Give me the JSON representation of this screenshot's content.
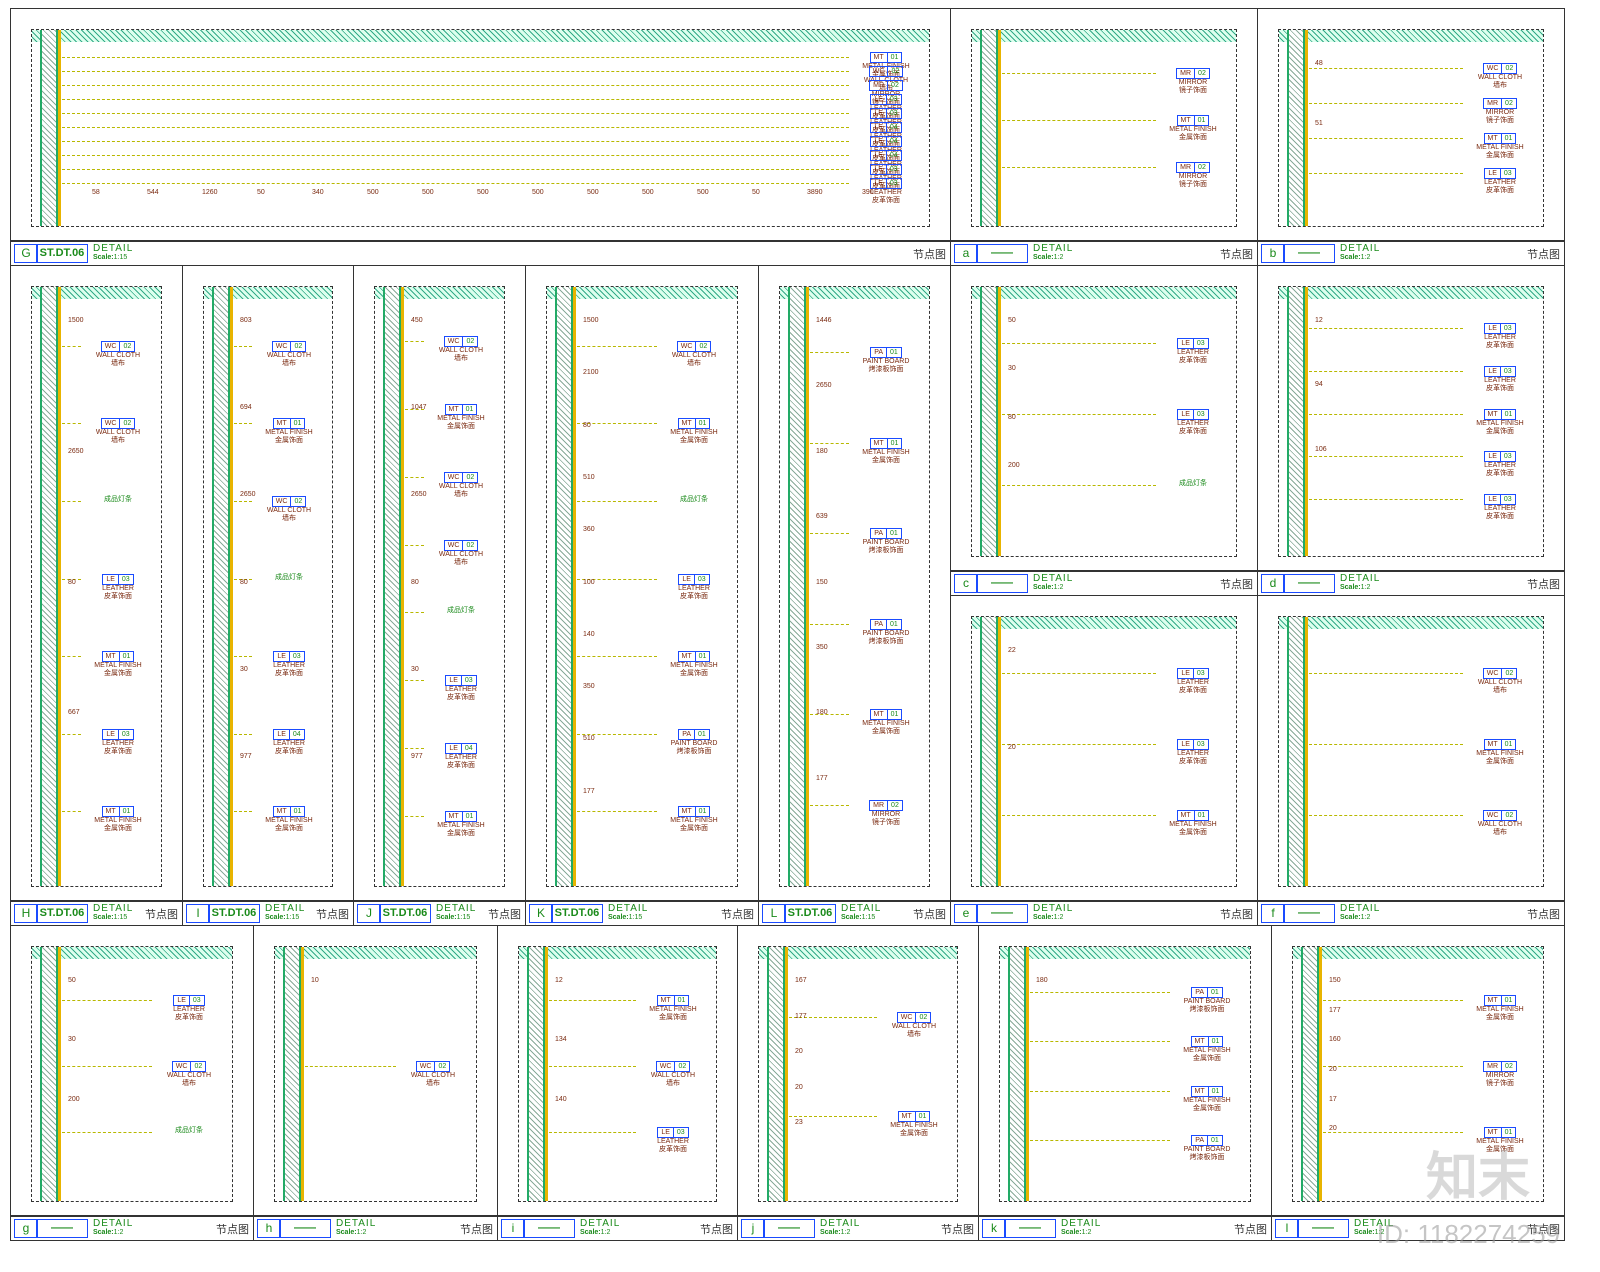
{
  "materials": {
    "MT": {
      "en": "METAL FINISH",
      "cn": "金属饰面"
    },
    "WC": {
      "en": "WALL CLOTH",
      "cn": "墙布"
    },
    "MR": {
      "en": "MIRROR",
      "cn": "镜子饰面"
    },
    "LE": {
      "en": "LEATHER",
      "cn": "皮革饰面"
    },
    "PA": {
      "en": "PAINT BOARD",
      "cn": "烤漆板饰面"
    }
  },
  "title_common": {
    "detail": "DETAIL",
    "scale_prefix": "Scale:",
    "node_cn": "节点图"
  },
  "panels": [
    {
      "letter": "G",
      "code": "ST.DT.06",
      "scale": "1:15",
      "tags": [
        "MT 01",
        "WC 02",
        "MR 02",
        "LE 03",
        "LE 03",
        "LE 04",
        "LE 04",
        "LE 04",
        "LE 03",
        "LE 03"
      ],
      "dims": [
        "58",
        "544",
        "1260",
        "50",
        "340",
        "500",
        "500",
        "500",
        "500",
        "500",
        "500",
        "500",
        "50",
        "3890",
        "390"
      ]
    },
    {
      "letter": "a",
      "code": "——",
      "scale": "1:2",
      "tags": [
        "MR 02",
        "MT 01",
        "MR 02"
      ],
      "dims": []
    },
    {
      "letter": "b",
      "code": "——",
      "scale": "1:2",
      "tags": [
        "WC 02",
        "MR 02",
        "MT 01",
        "LE 03"
      ],
      "dims": [
        "48",
        "51"
      ]
    },
    {
      "letter": "H",
      "code": "ST.DT.06",
      "scale": "1:15",
      "tags": [
        "WC 02",
        "WC 02",
        "成品灯条",
        "LE 03",
        "MT 01",
        "LE 03",
        "MT 01"
      ],
      "dims": [
        "1500",
        "2650",
        "80",
        "667"
      ]
    },
    {
      "letter": "I",
      "code": "ST.DT.06",
      "scale": "1:15",
      "tags": [
        "WC 02",
        "MT 01",
        "WC 02",
        "成品灯条",
        "LE 03",
        "LE 04",
        "MT 01"
      ],
      "dims": [
        "803",
        "694",
        "2650",
        "80",
        "30",
        "977"
      ]
    },
    {
      "letter": "J",
      "code": "ST.DT.06",
      "scale": "1:15",
      "tags": [
        "WC 02",
        "MT 01",
        "WC 02",
        "WC 02",
        "成品灯条",
        "LE 03",
        "LE 04",
        "MT 01"
      ],
      "dims": [
        "450",
        "1047",
        "2650",
        "80",
        "30",
        "977"
      ]
    },
    {
      "letter": "K",
      "code": "ST.DT.06",
      "scale": "1:15",
      "tags": [
        "WC 02",
        "MT 01",
        "成品灯条",
        "LE 03",
        "MT 01",
        "PA 01",
        "MT 01"
      ],
      "dims": [
        "1500",
        "2100",
        "80",
        "510",
        "360",
        "100",
        "140",
        "350",
        "510",
        "177"
      ]
    },
    {
      "letter": "L",
      "code": "ST.DT.06",
      "scale": "1:15",
      "tags": [
        "PA 01",
        "MT 01",
        "PA 01",
        "PA 01",
        "MT 01",
        "MR 02"
      ],
      "dims": [
        "1446",
        "2650",
        "180",
        "639",
        "150",
        "350",
        "180",
        "177"
      ]
    },
    {
      "letter": "c",
      "code": "——",
      "scale": "1:2",
      "tags": [
        "LE 03",
        "LE 03",
        "成品灯条"
      ],
      "dims": [
        "50",
        "30",
        "80",
        "200"
      ]
    },
    {
      "letter": "d",
      "code": "——",
      "scale": "1:2",
      "tags": [
        "LE 03",
        "LE 03",
        "MT 01",
        "LE 03",
        "LE 03"
      ],
      "dims": [
        "12",
        "94",
        "106"
      ]
    },
    {
      "letter": "e",
      "code": "——",
      "scale": "1:2",
      "tags": [
        "LE 03",
        "LE 03",
        "MT 01"
      ],
      "dims": [
        "22",
        "20"
      ]
    },
    {
      "letter": "f",
      "code": "——",
      "scale": "1:2",
      "tags": [
        "WC 02",
        "MT 01",
        "WC 02"
      ],
      "dims": []
    },
    {
      "letter": "g",
      "code": "——",
      "scale": "1:2",
      "tags": [
        "LE 03",
        "WC 02",
        "成品灯条"
      ],
      "dims": [
        "50",
        "30",
        "200"
      ]
    },
    {
      "letter": "h",
      "code": "——",
      "scale": "1:2",
      "tags": [
        "WC 02"
      ],
      "dims": [
        "10"
      ]
    },
    {
      "letter": "i",
      "code": "——",
      "scale": "1:2",
      "tags": [
        "MT 01",
        "WC 02",
        "LE 03"
      ],
      "dims": [
        "12",
        "134",
        "140"
      ]
    },
    {
      "letter": "j",
      "code": "——",
      "scale": "1:2",
      "tags": [
        "WC 02",
        "MT 01"
      ],
      "dims": [
        "167",
        "177",
        "20",
        "20",
        "23"
      ]
    },
    {
      "letter": "k",
      "code": "——",
      "scale": "1:2",
      "tags": [
        "PA 01",
        "MT 01",
        "MT 01",
        "PA 01"
      ],
      "dims": [
        "180"
      ]
    },
    {
      "letter": "l",
      "code": "——",
      "scale": "1:2",
      "tags": [
        "MT 01",
        "MR 02",
        "MT 01"
      ],
      "dims": [
        "150",
        "177",
        "160",
        "20",
        "17",
        "20"
      ]
    }
  ],
  "watermark": {
    "logo": "知末",
    "id": "ID: 1182274259"
  }
}
